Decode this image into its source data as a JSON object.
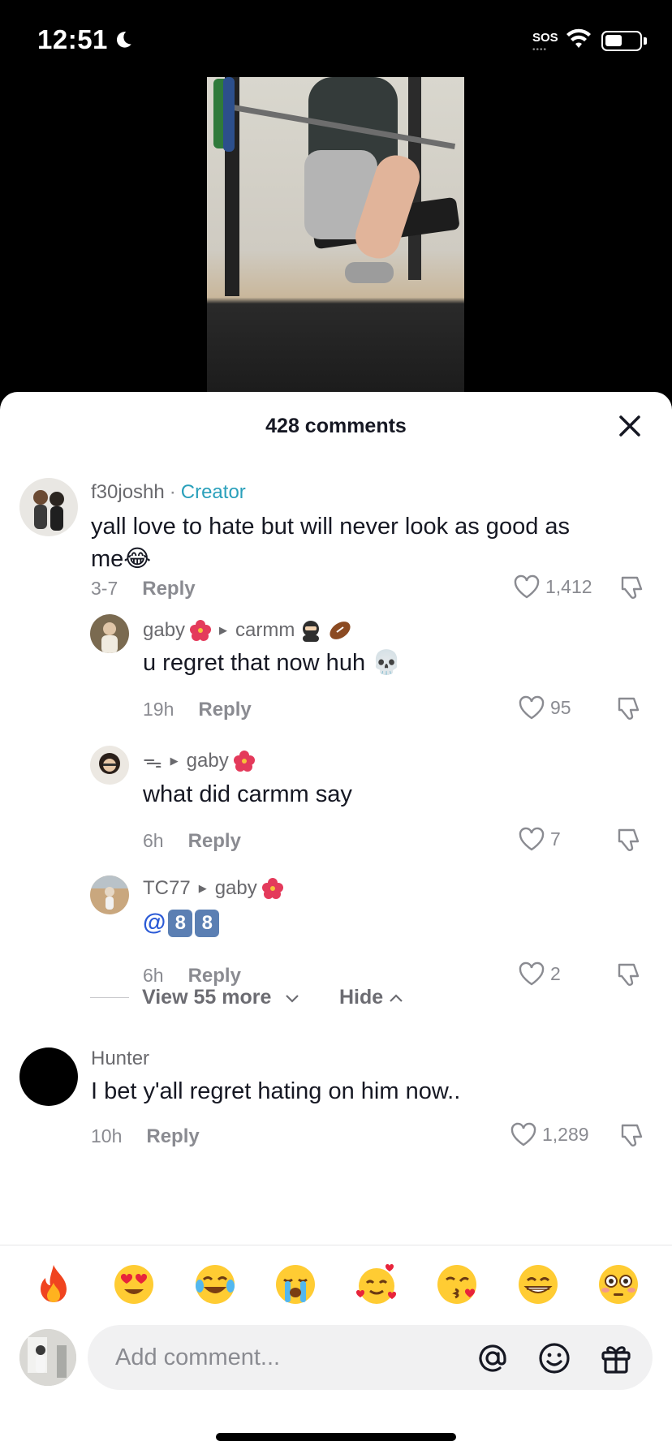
{
  "status_bar": {
    "time": "12:51",
    "sos": "SOS"
  },
  "sheet": {
    "title": "428 comments"
  },
  "comments": [
    {
      "user": "f30joshh",
      "separator": "·",
      "badge": "Creator",
      "text_line1": "yall love to hate but will never look as good as",
      "text_line2": "me😂",
      "time": "3-7",
      "reply_label": "Reply",
      "likes": "1,412"
    },
    {
      "user": "gaby",
      "reply_to": "carmm",
      "text": "u regret that now huh 💀",
      "time": "19h",
      "reply_label": "Reply",
      "likes": "95"
    },
    {
      "user": "ᯓ",
      "reply_to": "gaby",
      "text": "what did carmm say",
      "time": "6h",
      "reply_label": "Reply",
      "likes": "7"
    },
    {
      "user": "TC77",
      "reply_to": "gaby",
      "mention_at": "@",
      "mention_key1": "8",
      "mention_key2": "8",
      "time": "6h",
      "reply_label": "Reply",
      "likes": "2"
    },
    {
      "user": "Hunter",
      "text": "I bet y'all regret hating on him now..",
      "time": "10h",
      "reply_label": "Reply",
      "likes": "1,289"
    }
  ],
  "thread_controls": {
    "view_more": "View 55 more",
    "hide": "Hide"
  },
  "emoji_bar": [
    "fire-emoji",
    "heart-eyes-emoji",
    "joy-emoji",
    "sob-emoji",
    "smiling-hearts-emoji",
    "kiss-emoji",
    "grin-emoji",
    "flushed-emoji"
  ],
  "input": {
    "placeholder": "Add comment..."
  }
}
